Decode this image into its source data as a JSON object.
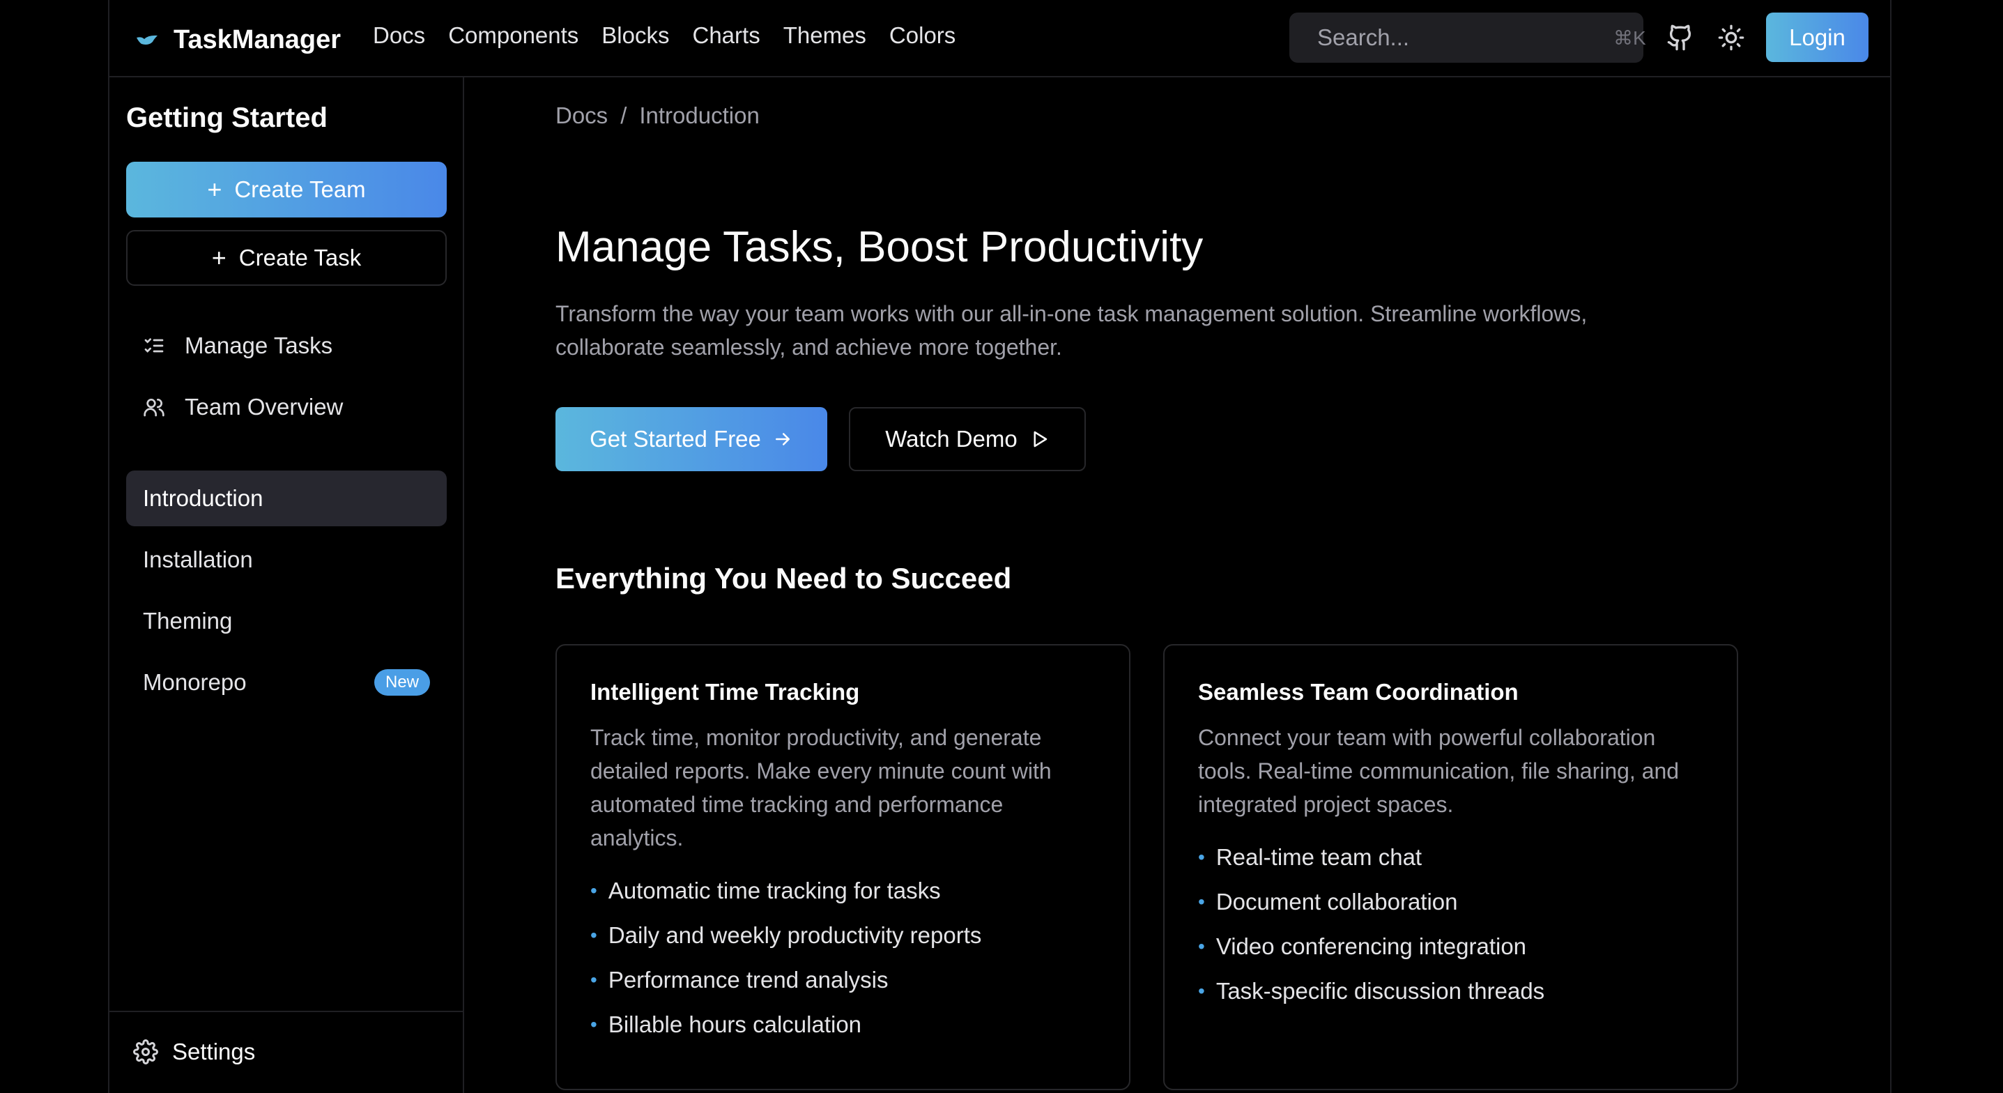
{
  "brand": {
    "name": "TaskManager",
    "accent_start": "#5bb7dd",
    "accent_end": "#4a88e8"
  },
  "nav": [
    "Docs",
    "Components",
    "Blocks",
    "Charts",
    "Themes",
    "Colors"
  ],
  "search": {
    "placeholder": "Search...",
    "shortcut": "⌘K"
  },
  "header": {
    "login_label": "Login",
    "icons": [
      "github-icon",
      "sun-icon"
    ]
  },
  "sidebar": {
    "title": "Getting Started",
    "create_team": "Create Team",
    "create_task": "Create Task",
    "nav": [
      {
        "label": "Manage Tasks",
        "icon": "list-checks-icon"
      },
      {
        "label": "Team Overview",
        "icon": "users-icon"
      }
    ],
    "docs": [
      {
        "label": "Introduction",
        "active": true
      },
      {
        "label": "Installation"
      },
      {
        "label": "Theming"
      },
      {
        "label": "Monorepo",
        "badge": "New"
      }
    ],
    "settings_label": "Settings"
  },
  "main": {
    "breadcrumb": [
      "Docs",
      "/",
      "Introduction"
    ],
    "title": "Manage Tasks, Boost Productivity",
    "lead": "Transform the way your team works with our all-in-one task management solution. Streamline workflows, collaborate seamlessly, and achieve more together.",
    "cta_primary": "Get Started Free",
    "cta_secondary": "Watch Demo",
    "section_title": "Everything You Need to Succeed",
    "cards": [
      {
        "title": "Intelligent Time Tracking",
        "desc": "Track time, monitor productivity, and generate detailed reports. Make every minute count with automated time tracking and performance analytics.",
        "items": [
          "Automatic time tracking for tasks",
          "Daily and weekly productivity reports",
          "Performance trend analysis",
          "Billable hours calculation"
        ]
      },
      {
        "title": "Seamless Team Coordination",
        "desc": "Connect your team with powerful collaboration tools. Real-time communication, file sharing, and integrated project spaces.",
        "items": [
          "Real-time team chat",
          "Document collaboration",
          "Video conferencing integration",
          "Task-specific discussion threads"
        ]
      }
    ]
  }
}
